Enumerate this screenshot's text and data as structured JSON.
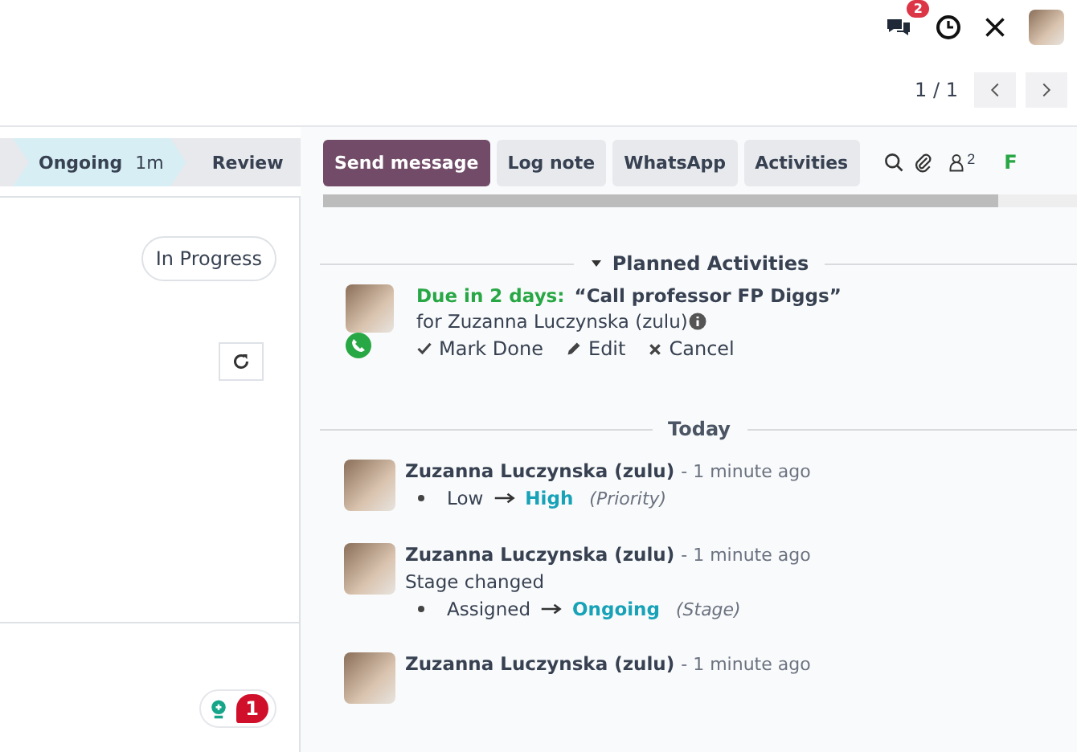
{
  "topbar": {
    "messages_badge": "2"
  },
  "pager": {
    "value": "1 / 1"
  },
  "stages": [
    {
      "label": "Ongoing",
      "duration": "1m",
      "selected": true
    },
    {
      "label": "Review",
      "selected": false
    }
  ],
  "form": {
    "status": "In Progress",
    "notification_count": "1"
  },
  "chatter": {
    "buttons": [
      {
        "label": "Send message",
        "selected": true
      },
      {
        "label": "Log note",
        "selected": false
      },
      {
        "label": "WhatsApp",
        "selected": false
      },
      {
        "label": "Activities",
        "selected": false
      }
    ],
    "followers": "2",
    "follow_label": "F",
    "planned_title": "Planned Activities",
    "planned_expanded": true,
    "activity": {
      "due": "Due in 2 days:",
      "summary": "“Call professor FP Diggs”",
      "assignee": "for Zuzanna Luczynska (zulu)",
      "actions": [
        {
          "kind": "done",
          "label": "Mark Done"
        },
        {
          "kind": "edit",
          "label": "Edit"
        },
        {
          "kind": "cancel",
          "label": "Cancel"
        }
      ]
    },
    "date_separator": "Today",
    "messages": [
      {
        "author": "Zuzanna Luczynska (zulu)",
        "time": "- 1 minute ago",
        "old": "Low",
        "new": "High",
        "field": "(Priority)"
      },
      {
        "author": "Zuzanna Luczynska (zulu)",
        "time": "- 1 minute ago",
        "body": "Stage changed",
        "old": "Assigned",
        "new": "Ongoing",
        "field": "(Stage)"
      },
      {
        "author": "Zuzanna Luczynska (zulu)",
        "time": "- 1 minute ago"
      }
    ]
  }
}
